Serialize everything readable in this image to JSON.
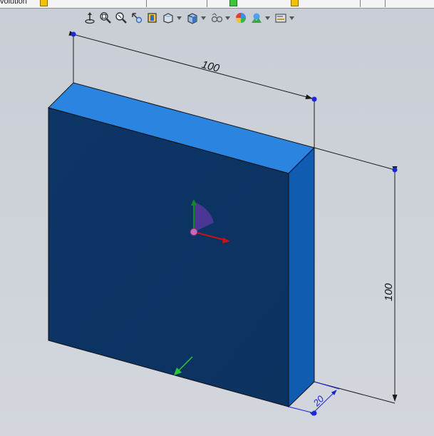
{
  "tabs": {
    "tab1_label": "volution",
    "icon_color_a": "#f2c200",
    "icon_color_b": "#3cc43c"
  },
  "toolbar": {
    "buttons": [
      {
        "name": "view-orientation-icon"
      },
      {
        "name": "zoom-to-fit-icon"
      },
      {
        "name": "zoom-to-area-icon"
      },
      {
        "name": "previous-view-icon"
      },
      {
        "name": "section-view-icon"
      },
      {
        "name": "dynamic-annotation-views-icon"
      },
      {
        "name": "view-orientation-cube-icon"
      },
      {
        "name": "display-style-icon"
      },
      {
        "name": "hide-show-items-icon"
      },
      {
        "name": "edit-appearance-icon"
      },
      {
        "name": "apply-scene-icon"
      },
      {
        "name": "view-settings-icon"
      }
    ]
  },
  "dimensions": {
    "width_label": "100",
    "height_label": "100",
    "depth_label": "20"
  },
  "colors": {
    "front_face": "#0d3668",
    "top_face": "#2b84e0",
    "side_face": "#0f5cb1",
    "dimension_line": "#1b1b1b",
    "dimension_point": "#1d2ad4",
    "triad_x": "#cc1111",
    "triad_y": "#0f8b22",
    "triad_z": "#2dc63a"
  }
}
